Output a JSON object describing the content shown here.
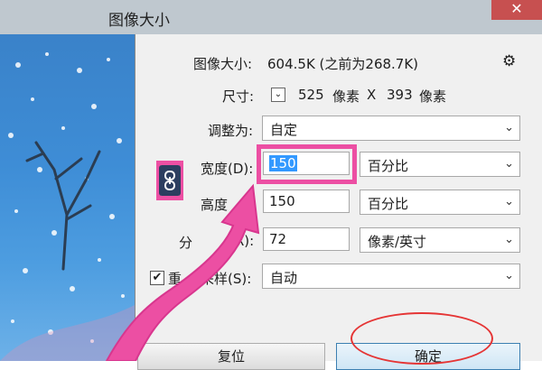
{
  "window": {
    "title": "图像大小",
    "close_label": "✕"
  },
  "image_size": {
    "label": "图像大小:",
    "value": "604.5K (之前为268.7K)"
  },
  "dimensions": {
    "label": "尺寸:",
    "width": "525",
    "unit1": "像素",
    "x": "X",
    "height": "393",
    "unit2": "像素"
  },
  "resize_to": {
    "label": "调整为:",
    "value": "自定"
  },
  "width": {
    "label": "宽度(D):",
    "value": "150",
    "unit": "百分比"
  },
  "height": {
    "label": "高度",
    "value": "150",
    "unit": "百分比"
  },
  "resolution": {
    "label": "分",
    "label_tail": "(R):",
    "value": "72",
    "unit": "像素/英寸"
  },
  "resample": {
    "label_head": "重",
    "label_tail": "采样(S):",
    "value": "自动",
    "checked": "✔"
  },
  "buttons": {
    "reset": "复位",
    "ok": "确定"
  },
  "icons": {
    "gear": "⚙",
    "chain": "🔗",
    "chevron": "⌄"
  },
  "colors": {
    "highlight": "#ec4fa3",
    "ok_circle": "#e53535",
    "selection": "#3399ff"
  }
}
